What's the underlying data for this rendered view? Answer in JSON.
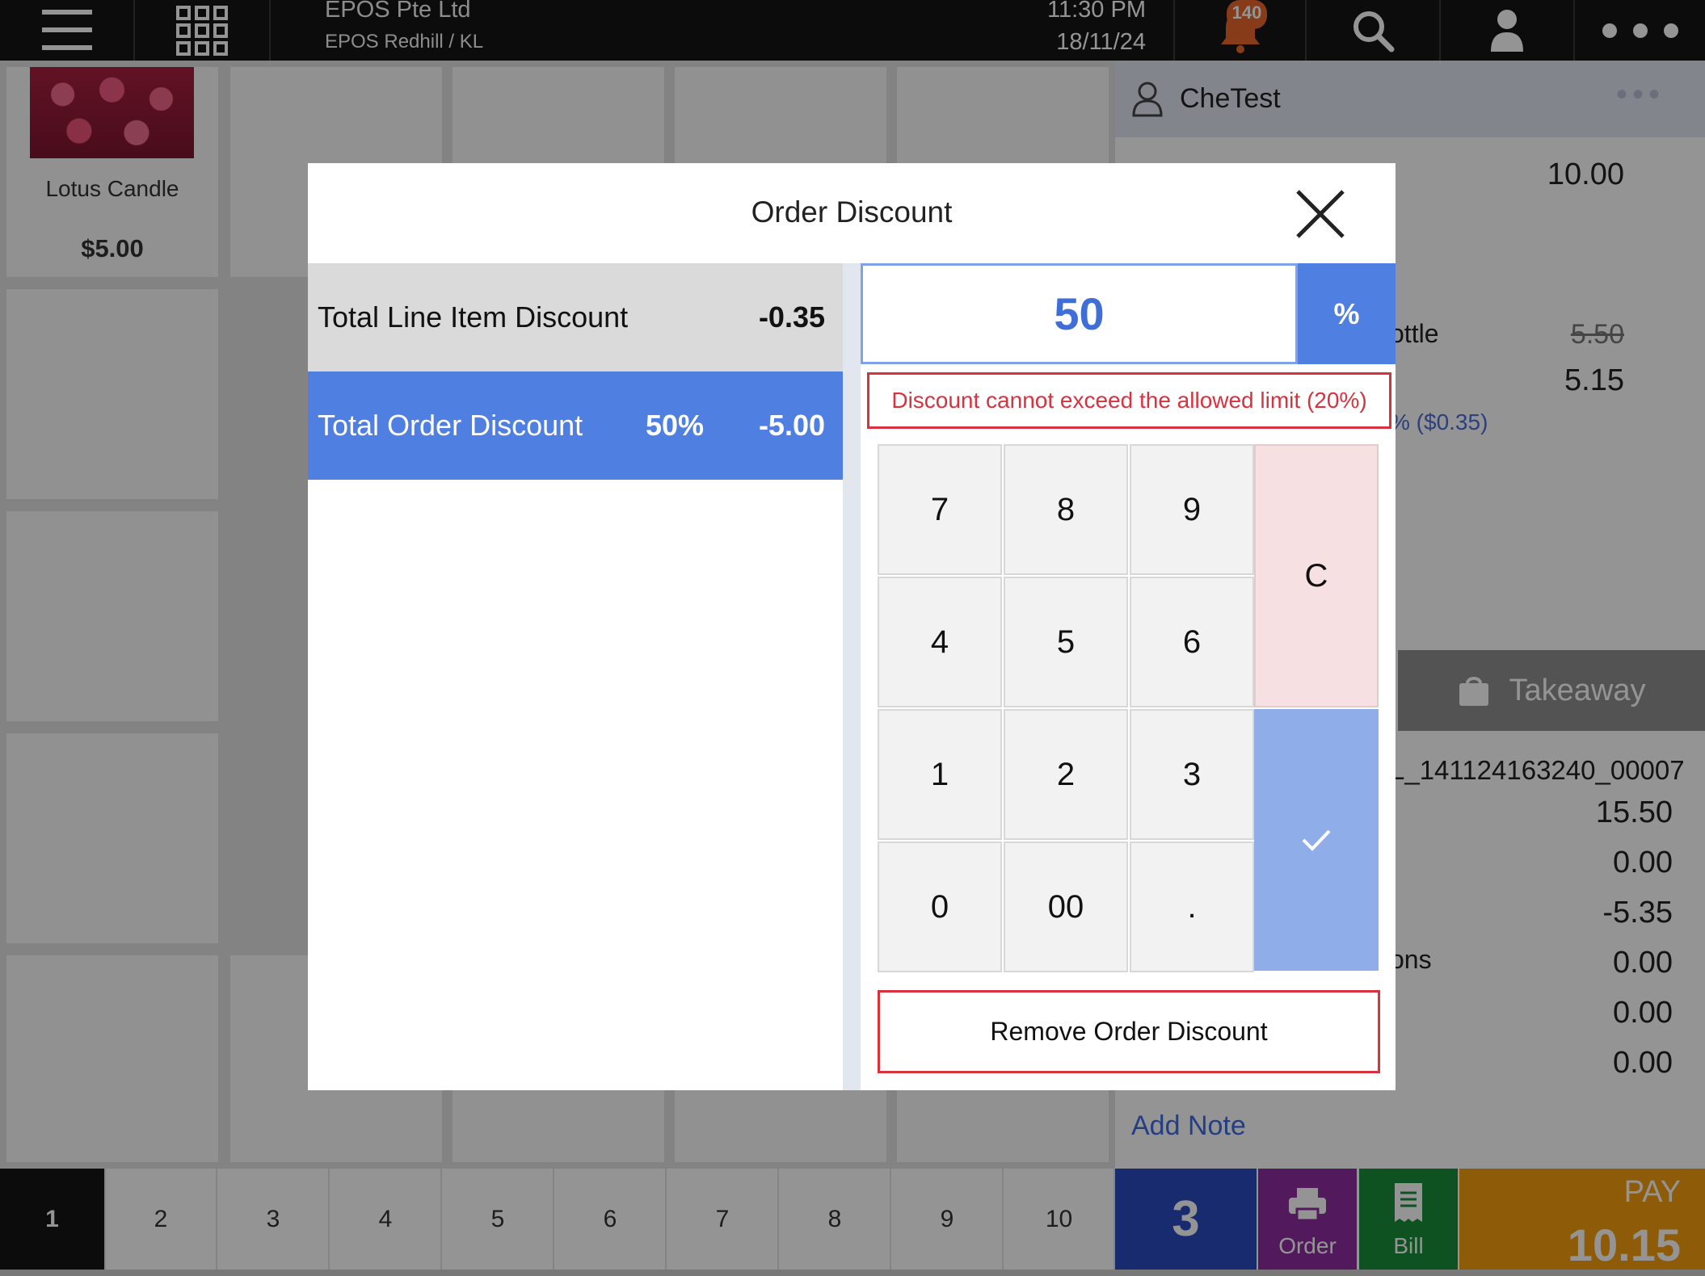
{
  "topbar": {
    "company": "EPOS Pte Ltd",
    "store": "EPOS Redhill / KL",
    "time": "11:30 PM",
    "date": "18/11/24",
    "notifications": "140"
  },
  "product": {
    "name": "Lotus Candle",
    "price": "$5.00"
  },
  "order_panel": {
    "customer": "CheTest",
    "item_total": "10.00",
    "item_name_fragment": "ottle",
    "item_original_price": "5.50",
    "item_price": "5.15",
    "item_discount_note": "% ($0.35)",
    "order_type": "Takeaway",
    "order_id_fragment": "L_141124163240_00007",
    "summary_values": [
      "15.50",
      "0.00",
      "-5.35",
      "0.00",
      "0.00",
      "0.00"
    ],
    "summary_label_fragment": "ons",
    "add_note": "Add Note"
  },
  "bottombar": {
    "pages": [
      "1",
      "2",
      "3",
      "4",
      "5",
      "6",
      "7",
      "8",
      "9",
      "10"
    ],
    "active_page": "1",
    "pending_count": "3",
    "order_label": "Order",
    "bill_label": "Bill",
    "pay_label": "PAY",
    "pay_amount": "10.15"
  },
  "modal": {
    "title": "Order Discount",
    "rows": [
      {
        "label": "Total Line Item Discount",
        "percent": "",
        "amount": "-0.35"
      },
      {
        "label": "Total Order Discount",
        "percent": "50%",
        "amount": "-5.00"
      }
    ],
    "input_value": "50",
    "unit_toggle": "%",
    "error": "Discount cannot exceed the allowed limit (20%)",
    "keys": [
      "7",
      "8",
      "9",
      "4",
      "5",
      "6",
      "1",
      "2",
      "3",
      "0",
      "00",
      "."
    ],
    "clear_key": "C",
    "remove_button": "Remove Order Discount"
  },
  "colors": {
    "accent": "#4f7fe0",
    "error": "#d9323f",
    "pending": "#2a4bbd",
    "order": "#8e2d9f",
    "bill": "#1b8e3b",
    "pay": "#f59d10"
  }
}
